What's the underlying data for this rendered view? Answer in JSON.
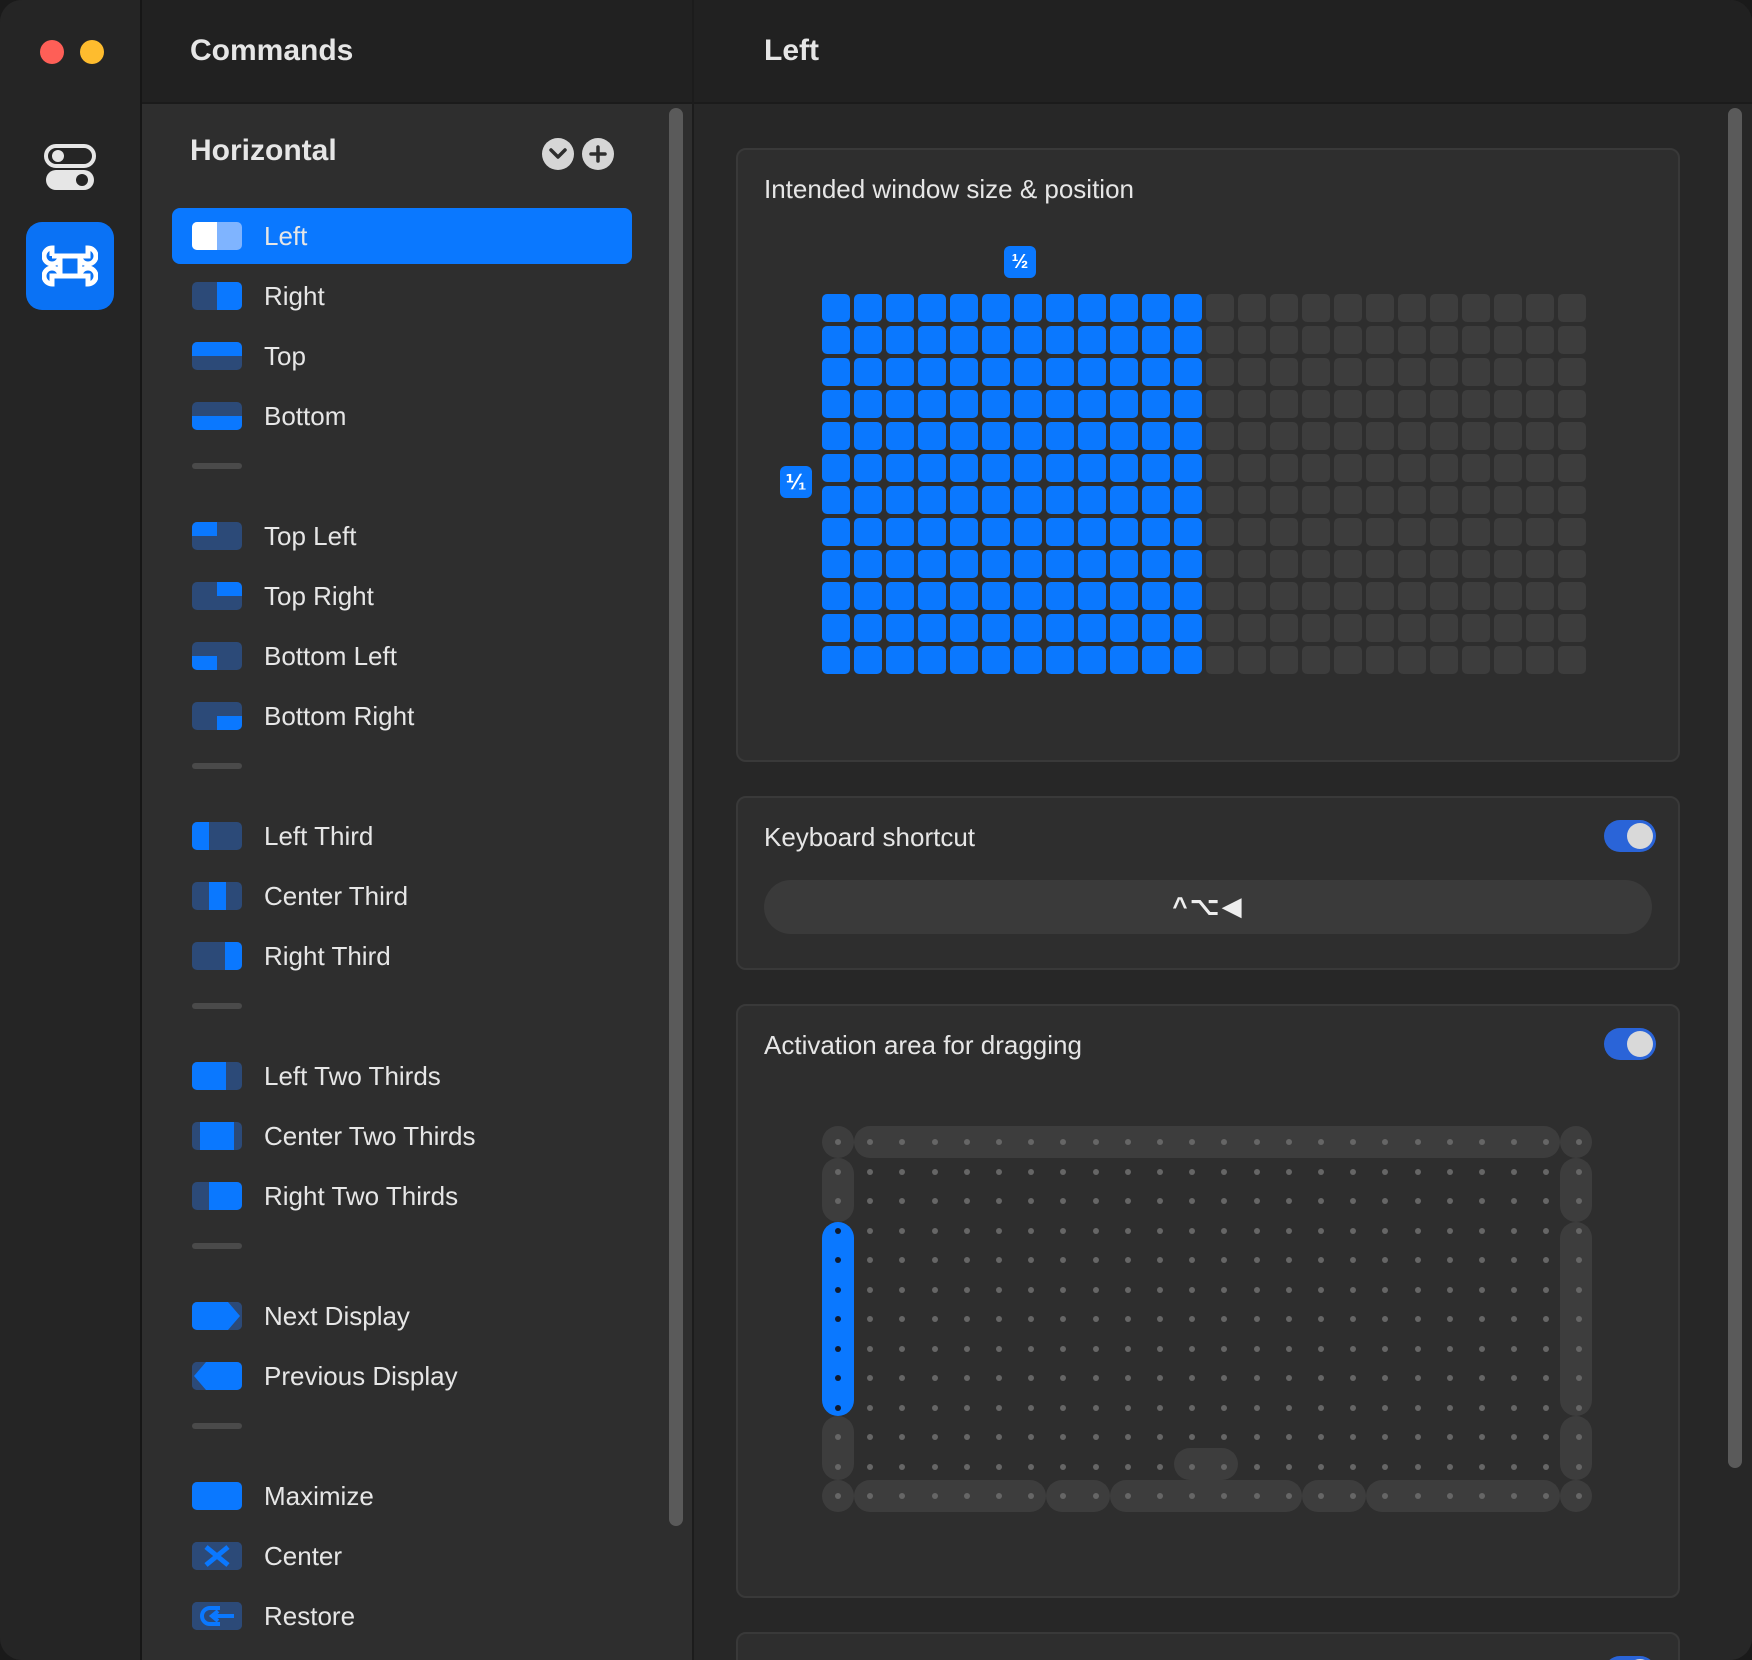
{
  "sidebar": {
    "header_title": "Commands",
    "group_title": "Horizontal",
    "items": [
      {
        "label": "Left",
        "icon": "left-half-icon",
        "selected": true
      },
      {
        "label": "Right",
        "icon": "right-half-icon"
      },
      {
        "label": "Top",
        "icon": "top-half-icon"
      },
      {
        "label": "Bottom",
        "icon": "bottom-half-icon"
      },
      {
        "separator": true
      },
      {
        "label": "Top Left",
        "icon": "top-left-quarter-icon"
      },
      {
        "label": "Top Right",
        "icon": "top-right-quarter-icon"
      },
      {
        "label": "Bottom Left",
        "icon": "bottom-left-quarter-icon"
      },
      {
        "label": "Bottom Right",
        "icon": "bottom-right-quarter-icon"
      },
      {
        "separator": true
      },
      {
        "label": "Left Third",
        "icon": "left-third-icon"
      },
      {
        "label": "Center Third",
        "icon": "center-third-icon"
      },
      {
        "label": "Right Third",
        "icon": "right-third-icon"
      },
      {
        "separator": true
      },
      {
        "label": "Left Two Thirds",
        "icon": "left-two-thirds-icon"
      },
      {
        "label": "Center Two Thirds",
        "icon": "center-two-thirds-icon"
      },
      {
        "label": "Right Two Thirds",
        "icon": "right-two-thirds-icon"
      },
      {
        "separator": true
      },
      {
        "label": "Next Display",
        "icon": "next-display-icon"
      },
      {
        "label": "Previous Display",
        "icon": "previous-display-icon"
      },
      {
        "separator": true
      },
      {
        "label": "Maximize",
        "icon": "maximize-icon"
      },
      {
        "label": "Center",
        "icon": "center-icon"
      },
      {
        "label": "Restore",
        "icon": "restore-icon"
      }
    ]
  },
  "detail": {
    "title": "Left",
    "size_card": {
      "title": "Intended window size & position",
      "width_fraction": "½",
      "height_fraction": "⅟₁",
      "grid_columns": 24,
      "grid_rows": 12,
      "filled_columns": 12
    },
    "shortcut_card": {
      "title": "Keyboard shortcut",
      "enabled": true,
      "shortcut": "^⌥◀"
    },
    "activation_card": {
      "title": "Activation area for dragging",
      "enabled": true,
      "active_zone": "left-edge-middle"
    }
  },
  "colors": {
    "accent": "#0a78ff",
    "window_bg": "#262626",
    "card_bg": "#2e2e2e",
    "cell_empty": "#3d3d3d",
    "traffic_red": "#fe5f57",
    "traffic_yellow": "#febc2e"
  }
}
